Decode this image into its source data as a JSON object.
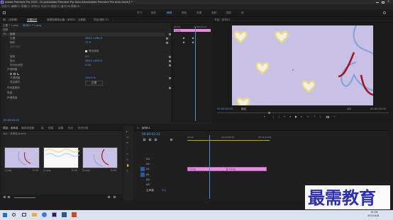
{
  "titlebar": {
    "title": "Adobe Premiere Pro 2020 - D:\\zyb\\Adobe Premiere Pro Auto-Save\\Adobe Premiere Pro Auto-Save\\1 *"
  },
  "menu": [
    "文件(F)",
    "编辑(E)",
    "剪辑(C)",
    "序列(S)",
    "标记(M)",
    "图形(G)",
    "窗口(W)",
    "帮助(H)"
  ],
  "workspaces": [
    "学习",
    "组件",
    "编辑",
    "颜色",
    "效果",
    "音频",
    "图形",
    "库"
  ],
  "workspace_active": "编辑",
  "effect_controls": {
    "tabs": [
      "源：(无剪辑)",
      "效果控件",
      "音频剪辑混合器：序列01",
      "元数据",
      "项目 图形 01"
    ],
    "source": "主要 * 1.png",
    "clip": "序列01 * 1.png",
    "section_video": "视频",
    "motion": "运动",
    "params": [
      {
        "name": "位置",
        "value": "360.0   1280.0"
      },
      {
        "name": "缩放",
        "value": "27.0"
      },
      {
        "name": "缩放宽度",
        "value": ""
      },
      {
        "name": "等比缩放",
        "value": ""
      },
      {
        "name": "旋转",
        "value": "0.0"
      },
      {
        "name": "锚点",
        "value": "360.0   1024.0"
      },
      {
        "name": "防闪烁滤镜",
        "value": "0.00"
      },
      {
        "name": "不透明度",
        "value": ""
      },
      {
        "name": "不透明度",
        "value": "100.0 %"
      },
      {
        "name": "混合模式",
        "value": "正常"
      },
      {
        "name": "时间重映射",
        "value": ""
      },
      {
        "name": "音量",
        "value": ""
      },
      {
        "name": "声道音量",
        "value": ""
      }
    ],
    "uniform_scale_label": "等比缩放",
    "ruler": [
      "00:00",
      "00:00:04:23"
    ],
    "clip_name": "1.png",
    "timecode": "00:00:02:23"
  },
  "program": {
    "title": "节目：序列01",
    "timecode": "00:00:02:23",
    "fit": "适合",
    "quality": "1/2",
    "duration": "00:00:10:00"
  },
  "project": {
    "tabs": [
      "项目：未命名",
      "媒体浏览器",
      "库",
      "信息",
      "效果",
      "标记",
      "历史记录"
    ],
    "path": "1pc - 未命名.prproj",
    "items": [
      {
        "name": "1.png",
        "duration": "5:00"
      },
      {
        "name": "2.png",
        "duration": "5:00"
      },
      {
        "name": "3.png",
        "duration": "5:00"
      }
    ]
  },
  "timeline": {
    "tab": "序列01",
    "timecode": "00:00:02:23",
    "ruler": [
      "00:00",
      "00:00:05:00",
      "00:00:10:00"
    ],
    "tracks": [
      "V3",
      "V2",
      "V1",
      "A1",
      "A2",
      "A3",
      "主声道"
    ],
    "master_value": "0.0",
    "clip_a": "1.png",
    "clip_b": "2.png"
  },
  "taskbar": {
    "time": "15:26",
    "date": "2022/4/8"
  },
  "watermark": "最需教育",
  "colors": {
    "accent": "#5aa7ff",
    "clip": "#e98ce4",
    "preview_bg": "#c9c0e5",
    "playhead": "#4a90d9"
  }
}
